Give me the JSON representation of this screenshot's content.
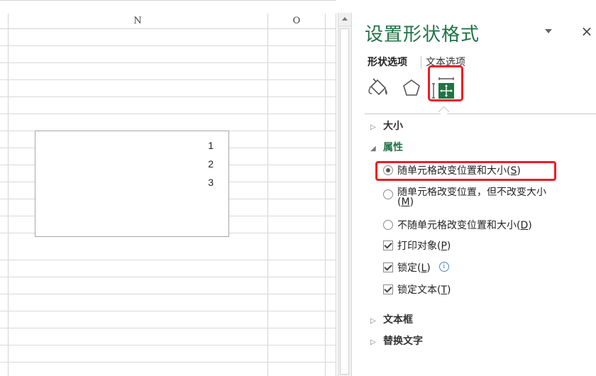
{
  "sheet": {
    "columns": [
      {
        "label": "N"
      },
      {
        "label": "O"
      }
    ],
    "textbox_lines": [
      "1",
      "2",
      "3"
    ]
  },
  "pane": {
    "title": "设置形状格式",
    "close_label": "×",
    "tabs": {
      "shape_options": "形状选项",
      "text_options": "文本选项"
    },
    "icons": [
      "fill-line-icon",
      "effects-icon",
      "size-properties-icon"
    ],
    "sections": {
      "size": "大小",
      "properties": "属性",
      "textbox": "文本框",
      "alt_text": "替换文字"
    },
    "properties": {
      "radio1": {
        "text": "随单元格改变位置和大小(",
        "key": "S",
        "tail": ")",
        "selected": true
      },
      "radio2": {
        "text": "随单元格改变位置，但不改变大小(",
        "key": "M",
        "tail": ")",
        "selected": false
      },
      "radio3": {
        "text": "不随单元格改变位置和大小(",
        "key": "D",
        "tail": ")",
        "selected": false
      },
      "print": {
        "text": "打印对象(",
        "key": "P",
        "tail": ")",
        "checked": true
      },
      "locked": {
        "text": "锁定(",
        "key": "L",
        "tail": ")",
        "checked": true
      },
      "lock_text": {
        "text": "锁定文本(",
        "key": "T",
        "tail": ")",
        "checked": true
      }
    }
  },
  "colors": {
    "accent": "#217346",
    "highlight": "#ee1c24"
  }
}
